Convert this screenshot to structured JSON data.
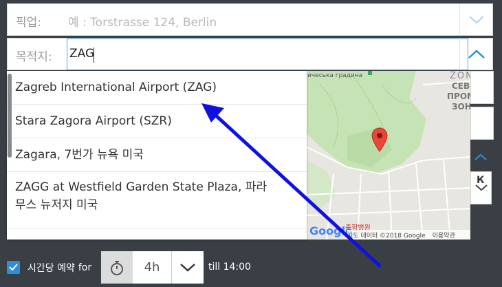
{
  "pickup": {
    "label": "픽업:",
    "placeholder": "예 : Torstrasse 124, Berlin"
  },
  "destination": {
    "label": "목적지:",
    "value": "ZAG"
  },
  "suggestions": [
    {
      "text": "Zagreb International Airport (ZAG)"
    },
    {
      "text": "Stara Zagora Airport (SZR)"
    },
    {
      "text": "Zagara, 7번가 뉴욕 미국"
    },
    {
      "text": "ZAGG at Westfield Garden State Plaza, 파라무스 뉴저지 미국"
    }
  ],
  "map": {
    "label_top": "ичеська градина",
    "district_1": "ZON",
    "district_2": "СЕВЕ",
    "district_3": "ПРОМИШ",
    "district_4": "ЗОН",
    "hospital": "종합병원",
    "attribution": "지도 데이터 ©2018 Google",
    "terms": "이용약관",
    "logo": "Google",
    "side_letter": "К"
  },
  "hourly": {
    "checkbox_label": "시간당 예약",
    "for_label": "for",
    "hours": "4h",
    "till_label": "till 14:00"
  },
  "colors": {
    "accent": "#2d8fd6",
    "arrow": "#1010e0",
    "pin": "#e8463a"
  }
}
